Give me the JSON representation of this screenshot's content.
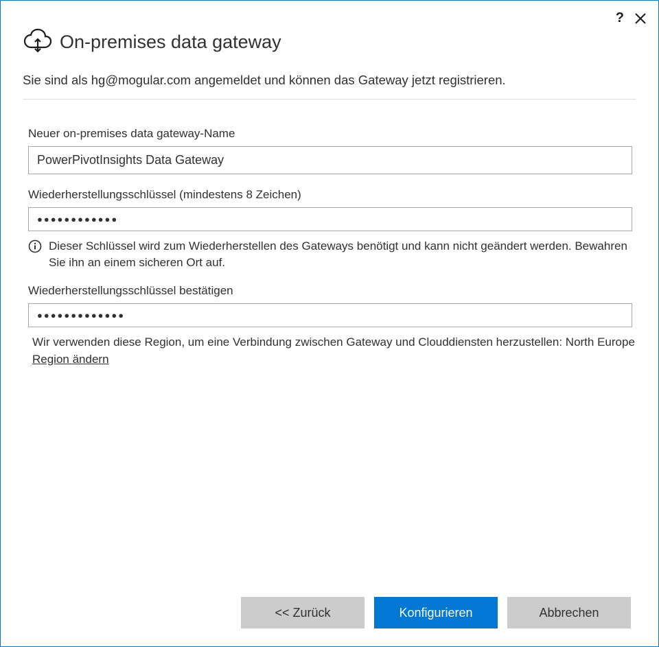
{
  "header": {
    "title": "On-premises data gateway"
  },
  "intro": "Sie sind als hg@mogular.com angemeldet und können das Gateway jetzt registrieren.",
  "fields": {
    "gateway_name": {
      "label": "Neuer on-premises data gateway-Name",
      "value": "PowerPivotInsights Data Gateway"
    },
    "recovery_key": {
      "label": "Wiederherstellungsschlüssel (mindestens 8 Zeichen)",
      "value": "●●●●●●●●●●●●",
      "info": "Dieser Schlüssel wird zum Wiederherstellen des Gateways benötigt und kann nicht geändert werden. Bewahren Sie ihn an einem sicheren Ort auf."
    },
    "recovery_key_confirm": {
      "label": "Wiederherstellungsschlüssel bestätigen",
      "value": "●●●●●●●●●●●●●"
    }
  },
  "region": {
    "text_prefix": "Wir verwenden diese Region, um eine Verbindung zwischen Gateway und Clouddiensten herzustellen: North Europe ",
    "link": "Region ändern"
  },
  "buttons": {
    "back": "<< Zurück",
    "configure": "Konfigurieren",
    "cancel": "Abbrechen"
  }
}
